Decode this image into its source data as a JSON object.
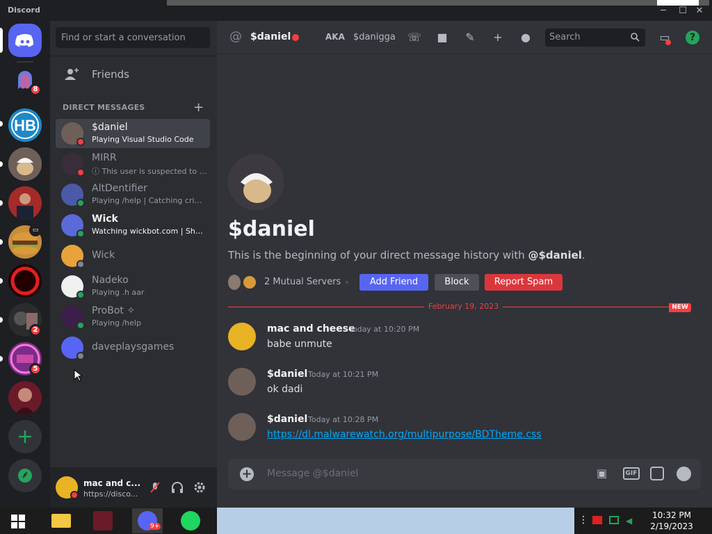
{
  "app": {
    "title": "Discord"
  },
  "window": {
    "minimize": "─",
    "maximize": "☐",
    "close": "✕"
  },
  "guilds": {
    "dm_badge": "8",
    "badge_2": "2",
    "badge_5": "5"
  },
  "dm_panel": {
    "search_placeholder": "Find or start a conversation",
    "friends_label": "Friends",
    "section_header": "DIRECT MESSAGES",
    "add_dm": "+",
    "items": [
      {
        "name": "$daniel",
        "sub": "Playing Visual Studio Code",
        "status": "dnd"
      },
      {
        "name": "MIRR",
        "sub": "ⓘ This user is suspected to h...",
        "status": "dnd"
      },
      {
        "name": "AltDentifier",
        "sub": "Playing /help | Catching crimi...",
        "status": "online"
      },
      {
        "name": "Wick",
        "sub": "Watching wickbot.com | Shar...",
        "status": "online"
      },
      {
        "name": "Wick",
        "sub": "",
        "status": "offline"
      },
      {
        "name": "Nadeko",
        "sub": "Playing .h aar",
        "status": "online"
      },
      {
        "name": "ProBot ✧",
        "sub": "Playing /help",
        "status": "online"
      },
      {
        "name": "daveplaysgames",
        "sub": "",
        "status": "offline"
      }
    ]
  },
  "user_panel": {
    "name": "mac and c...",
    "status": "https://disco..."
  },
  "header": {
    "at": "@",
    "name": "$daniel",
    "aka_label": "AKA",
    "aka_value": "$danigga",
    "search_placeholder": "Search"
  },
  "profile": {
    "name": "$daniel",
    "intro_prefix": "This is the beginning of your direct message history with ",
    "intro_handle": "@$daniel",
    "intro_suffix": ".",
    "mutual": "2 Mutual Servers",
    "add_friend": "Add Friend",
    "block": "Block",
    "report": "Report Spam"
  },
  "divider": {
    "date": "February 19, 2023",
    "new_label": "NEW"
  },
  "messages": [
    {
      "author": "mac and cheese",
      "time": "Today at 10:20 PM",
      "text": "babe unmute"
    },
    {
      "author": "$daniel",
      "time": "Today at 10:21 PM",
      "text": "ok dadi"
    },
    {
      "author": "$daniel",
      "time": "Today at 10:28 PM",
      "text": "https://dl.malwarewatch.org/multipurpose/BDTheme.css"
    }
  ],
  "composer": {
    "placeholder": "Message @$daniel",
    "gif": "GIF"
  },
  "taskbar": {
    "time": "10:32 PM",
    "date": "2/19/2023",
    "discord_badge": "9+"
  },
  "colors": {
    "blurple": "#5865f2",
    "danger": "#da373c",
    "online": "#23a55a",
    "dnd": "#f23f43",
    "link": "#00a8fc"
  }
}
